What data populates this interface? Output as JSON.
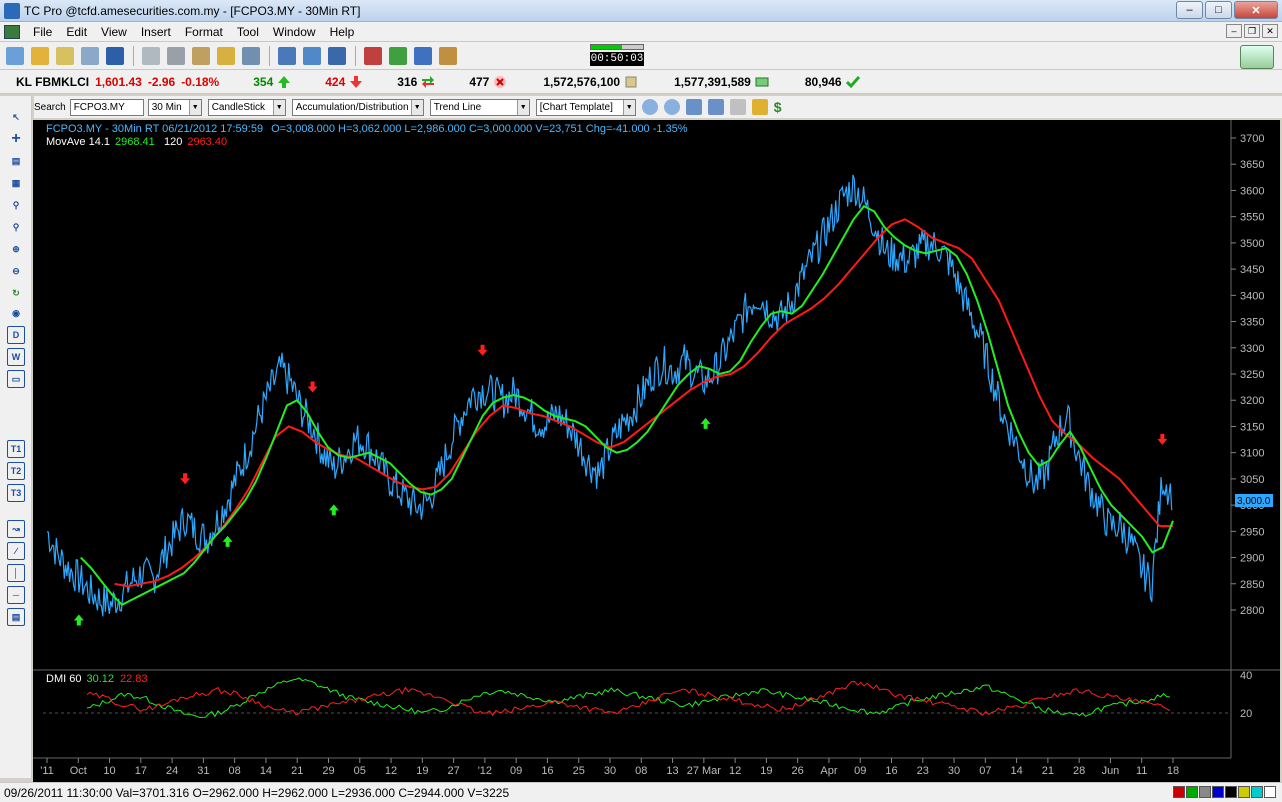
{
  "window": {
    "title": "TC Pro @tcfd.amesecurities.com.my - [FCPO3.MY - 30Min RT]"
  },
  "menu": [
    "File",
    "Edit",
    "View",
    "Insert",
    "Format",
    "Tool",
    "Window",
    "Help"
  ],
  "clock": "00:50:03",
  "ticker": {
    "index": "KL FBMKLCI",
    "value": "1,601.43",
    "change": "-2.96",
    "pct": "-0.18%",
    "up": "354",
    "down": "424",
    "unchanged": "316",
    "untraded": "477",
    "volume": "1,572,576,100",
    "value_traded": "1,577,391,589",
    "trades": "80,946"
  },
  "toolbar2": {
    "search_label": "Search",
    "symbol": "FCPO3.MY",
    "interval": "30 Min",
    "chart_type": "CandleStick",
    "indicator": "Accumulation/Distribution",
    "draw_tool": "Trend Line",
    "template": "[Chart Template]"
  },
  "chart": {
    "header": "FCPO3.MY - 30Min RT   06/21/2012  17:59:59",
    "ohlc": "O=3,008.000   H=3,062.000   L=2,986.000   C=3,000.000   V=23,751   Chg=-41.000  -1.35%",
    "ma_label": "MovAve 14.1",
    "ma_fast": "2968.41",
    "ma_slow_label": "120",
    "ma_slow": "2963.40",
    "price_tag": "3,000.0",
    "y_ticks": [
      "3700",
      "3650",
      "3600",
      "3550",
      "3500",
      "3450",
      "3400",
      "3350",
      "3300",
      "3250",
      "3200",
      "3150",
      "3100",
      "3050",
      "3000",
      "2950",
      "2900",
      "2850",
      "2800"
    ],
    "dmi_label": "DMI 60",
    "dmi_plus": "30.12",
    "dmi_minus": "22.83",
    "dmi_ticks": [
      "40",
      "20"
    ],
    "x_ticks": [
      "'11",
      "Oct",
      "10",
      "17",
      "24",
      "31",
      "08",
      "14",
      "21",
      "29",
      "05",
      "12",
      "19",
      "27",
      "'12",
      "09",
      "16",
      "25",
      "30",
      "08",
      "13",
      "27 Mar",
      "12",
      "19",
      "26",
      "Apr",
      "09",
      "16",
      "23",
      "30",
      "07",
      "14",
      "21",
      "28",
      "Jun",
      "11",
      "18"
    ]
  },
  "chart_data": {
    "type": "line",
    "y_range": [
      2770,
      3720
    ],
    "price": [
      2950,
      2905,
      2880,
      2860,
      2835,
      2820,
      2810,
      2830,
      2855,
      2870,
      2860,
      2905,
      2940,
      2975,
      2950,
      2935,
      2970,
      3010,
      3060,
      3110,
      3170,
      3220,
      3260,
      3230,
      3180,
      3150,
      3100,
      3070,
      3095,
      3125,
      3120,
      3090,
      3055,
      3030,
      3010,
      2995,
      3010,
      3060,
      3120,
      3170,
      3210,
      3220,
      3215,
      3200,
      3215,
      3190,
      3160,
      3155,
      3175,
      3155,
      3120,
      3080,
      3060,
      3110,
      3150,
      3175,
      3210,
      3250,
      3270,
      3255,
      3275,
      3250,
      3235,
      3260,
      3300,
      3340,
      3380,
      3400,
      3370,
      3355,
      3385,
      3430,
      3470,
      3510,
      3550,
      3590,
      3610,
      3575,
      3530,
      3480,
      3475,
      3465,
      3485,
      3500,
      3490,
      3460,
      3410,
      3360,
      3310,
      3240,
      3170,
      3130,
      3080,
      3040,
      3060,
      3130,
      3170,
      3100,
      3040,
      3000,
      2960,
      2960,
      2930,
      2880,
      2850,
      3050,
      3020
    ],
    "ma_fast": [
      2900,
      2880,
      2855,
      2830,
      2810,
      2820,
      2830,
      2840,
      2850,
      2860,
      2870,
      2890,
      2915,
      2940,
      2960,
      2985,
      3010,
      3045,
      3090,
      3140,
      3190,
      3200,
      3175,
      3140,
      3110,
      3095,
      3090,
      3095,
      3100,
      3090,
      3080,
      3060,
      3040,
      3025,
      3020,
      3030,
      3050,
      3090,
      3130,
      3170,
      3195,
      3205,
      3210,
      3205,
      3195,
      3180,
      3170,
      3165,
      3160,
      3150,
      3130,
      3110,
      3100,
      3105,
      3120,
      3140,
      3170,
      3200,
      3230,
      3250,
      3265,
      3260,
      3250,
      3255,
      3275,
      3310,
      3340,
      3365,
      3370,
      3365,
      3380,
      3410,
      3440,
      3475,
      3510,
      3545,
      3570,
      3560,
      3530,
      3510,
      3495,
      3485,
      3480,
      3485,
      3490,
      3475,
      3440,
      3390,
      3330,
      3260,
      3190,
      3140,
      3100,
      3075,
      3085,
      3115,
      3140,
      3110,
      3070,
      3030,
      3000,
      2980,
      2960,
      2940,
      2910,
      2920,
      2970
    ],
    "ma_slow": [
      2850,
      2845,
      2850,
      2855,
      2865,
      2880,
      2900,
      2925,
      2955,
      2990,
      3030,
      3080,
      3130,
      3150,
      3140,
      3120,
      3105,
      3095,
      3090,
      3075,
      3060,
      3045,
      3035,
      3030,
      3035,
      3060,
      3100,
      3140,
      3170,
      3190,
      3185,
      3175,
      3170,
      3160,
      3150,
      3135,
      3120,
      3110,
      3120,
      3140,
      3160,
      3180,
      3200,
      3220,
      3235,
      3245,
      3250,
      3265,
      3290,
      3320,
      3345,
      3360,
      3375,
      3395,
      3420,
      3450,
      3480,
      3510,
      3535,
      3545,
      3530,
      3510,
      3500,
      3490,
      3470,
      3430,
      3390,
      3330,
      3270,
      3210,
      3160,
      3135,
      3115,
      3090,
      3070,
      3050,
      3020,
      2990,
      2960,
      2960
    ],
    "dmi_plus": [
      22,
      26,
      30,
      28,
      24,
      20,
      18,
      20,
      24,
      30,
      34,
      38,
      36,
      32,
      28,
      26,
      24,
      22,
      20,
      22,
      26,
      30,
      32,
      30,
      28,
      26,
      28,
      30,
      32,
      30,
      28,
      26,
      24,
      26,
      28,
      30,
      32,
      30,
      28,
      26,
      24,
      22,
      20,
      22,
      26,
      28,
      30,
      32,
      34,
      30,
      26,
      22,
      20,
      18,
      22,
      24,
      26,
      28,
      30
    ],
    "dmi_minus": [
      30,
      28,
      24,
      22,
      24,
      28,
      30,
      32,
      30,
      26,
      22,
      20,
      22,
      24,
      26,
      28,
      30,
      32,
      30,
      28,
      24,
      20,
      20,
      22,
      24,
      26,
      24,
      22,
      20,
      22,
      26,
      30,
      32,
      30,
      28,
      26,
      24,
      22,
      24,
      28,
      32,
      36,
      34,
      30,
      28,
      26,
      24,
      22,
      20,
      22,
      24,
      28,
      30,
      32,
      30,
      28,
      26,
      24,
      22
    ],
    "buy_signals": [
      3,
      17,
      27,
      62
    ],
    "sell_signals": [
      13,
      25,
      41,
      105
    ]
  }
}
